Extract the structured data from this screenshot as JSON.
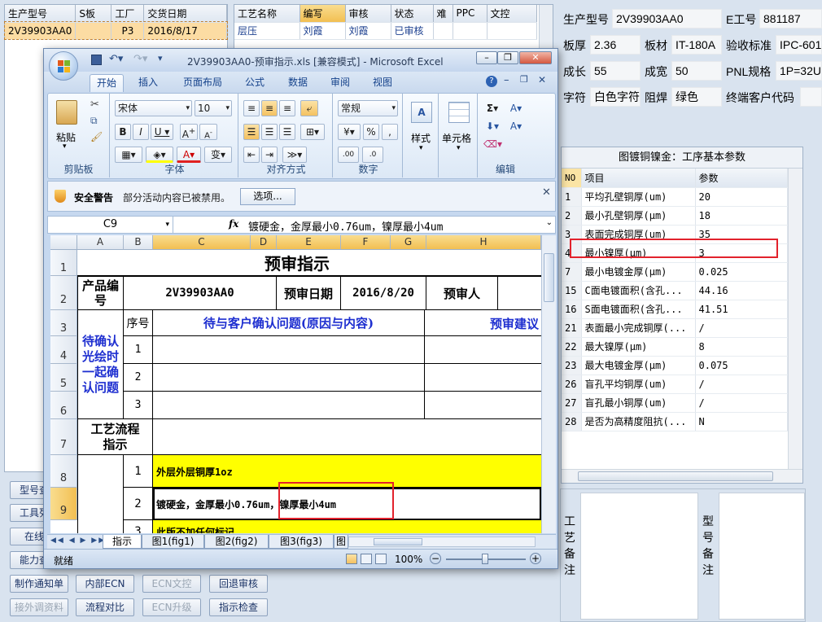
{
  "left_grid": {
    "headers": [
      "生产型号",
      "S板",
      "工厂",
      "交货日期"
    ],
    "row": [
      "2V39903AA0",
      "",
      "P3",
      "2016/8/17"
    ]
  },
  "mid_grid": {
    "headers": [
      "工艺名称",
      "编写",
      "审核",
      "状态",
      "难",
      "PPC",
      "文控"
    ],
    "row": [
      "层压",
      "刘霞",
      "刘霞",
      "已审核",
      "",
      "",
      ""
    ]
  },
  "left_buttons": [
    "型号查",
    "工具列",
    "在线",
    "能力查"
  ],
  "bottom_buttons": {
    "row1": [
      "制作通知单",
      "内部ECN",
      "ECN文控",
      "回退审核"
    ],
    "row2": [
      "接外调资料",
      "流程对比",
      "ECN升级",
      "指示检查"
    ]
  },
  "right_info": {
    "model_label": "生产型号",
    "model_value": "2V39903AA0",
    "eno_label": "E工号",
    "eno_value": "881187",
    "thick_label": "板厚",
    "thick_value": "2.36",
    "mat_label": "板材",
    "mat_value": "IT-180A",
    "std_label": "验收标准",
    "std_value": "IPC-601",
    "len_label": "成长",
    "len_value": "55",
    "wid_label": "成宽",
    "wid_value": "50",
    "pnl_label": "PNL规格",
    "pnl_value": "1P=32U",
    "char_label": "字符",
    "char_value": "白色字符",
    "mask_label": "阻焊",
    "mask_value": "绿色",
    "cust_label": "终端客户代码",
    "cust_value": ""
  },
  "param_panel": {
    "title": "图镀铜镍金：工序基本参数",
    "headers": [
      "NO",
      "项目",
      "参数"
    ],
    "rows": [
      [
        "1",
        "平均孔壁铜厚(um)",
        "20"
      ],
      [
        "2",
        "最小孔壁铜厚(μm)",
        "18"
      ],
      [
        "3",
        "表面完成铜厚(um)",
        "35"
      ],
      [
        "4",
        "最小镍厚(μm)",
        "3"
      ],
      [
        "7",
        "最小电镀金厚(μm)",
        "0.025"
      ],
      [
        "15",
        "C面电镀面积(含孔...",
        "44.16"
      ],
      [
        "16",
        "S面电镀面积(含孔...",
        "41.51"
      ],
      [
        "21",
        "表面最小完成铜厚(...",
        "/"
      ],
      [
        "22",
        "最大镍厚(μm)",
        "8"
      ],
      [
        "23",
        "最大电镀金厚(μm)",
        "0.075"
      ],
      [
        "26",
        "盲孔平均铜厚(um)",
        "/"
      ],
      [
        "27",
        "盲孔最小铜厚(um)",
        "/"
      ],
      [
        "28",
        "是否为高精度阻抗(...",
        "N"
      ]
    ]
  },
  "remarks": {
    "process": "工艺备注",
    "model": "型号备注"
  },
  "excel": {
    "title": "2V39903AA0-预审指示.xls  [兼容模式] - Microsoft Excel",
    "tabs": [
      "开始",
      "插入",
      "页面布局",
      "公式",
      "数据",
      "审阅",
      "视图"
    ],
    "font_name": "宋体",
    "font_size": "10",
    "number_format": "常规",
    "groups": [
      "剪贴板",
      "字体",
      "对齐方式",
      "数字",
      "样式",
      "单元格",
      "编辑"
    ],
    "paste_label": "粘贴",
    "style_label": "样式",
    "cell_label": "单元格",
    "security_title": "安全警告",
    "security_text": "部分活动内容已被禁用。",
    "options_button": "选项...",
    "name_box": "C9",
    "formula": "镀硬金，金厚最小0.76um，镍厚最小4um",
    "columns": [
      "A",
      "B",
      "C",
      "D",
      "E",
      "F",
      "G",
      "H"
    ],
    "rows": [
      "1",
      "2",
      "3",
      "4",
      "5",
      "6",
      "7",
      "8",
      "9"
    ],
    "sheet": {
      "title": "预审指示",
      "product_label": "产品编号",
      "product_no": "2V39903AA0",
      "date_label": "预审日期",
      "date_value": "2016/8/20",
      "reviewer_label": "预审人",
      "seq_label": "序号",
      "question_header": "待与客户确认问题(原因与内容)",
      "suggest_header": "预审建议",
      "confirm_label": "待确认光绘时一起确认问题",
      "seq": [
        "1",
        "2",
        "3"
      ],
      "flow_label": "工艺流程指示",
      "items": [
        {
          "no": "1",
          "text": "外层外层铜厚1oz"
        },
        {
          "no": "2",
          "text": "镀硬金，金厚最小0.76um，镍厚最小4um"
        },
        {
          "no": "3",
          "text": "此版不加任何标记"
        }
      ]
    },
    "sheet_tabs": [
      "指示",
      "图1(fig1)",
      "图2(fig2)",
      "图3(fig3)",
      "图"
    ],
    "status": "就绪",
    "zoom": "100%"
  }
}
